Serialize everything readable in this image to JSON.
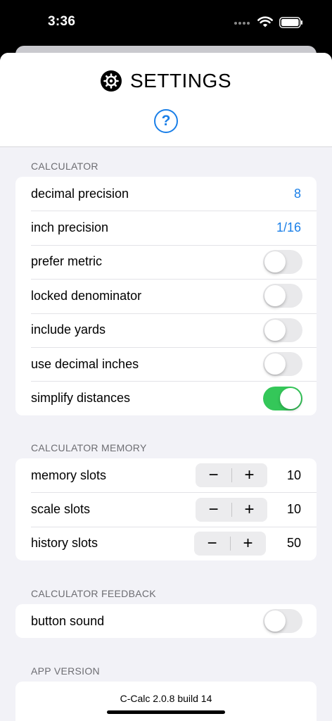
{
  "status_bar": {
    "time": "3:36"
  },
  "header": {
    "title": "SETTINGS",
    "help_label": "?"
  },
  "sections": {
    "calculator": {
      "label": "CALCULATOR",
      "decimal_precision": {
        "label": "decimal precision",
        "value": "8"
      },
      "inch_precision": {
        "label": "inch precision",
        "value": "1/16"
      },
      "prefer_metric": {
        "label": "prefer metric",
        "on": false
      },
      "locked_denominator": {
        "label": "locked denominator",
        "on": false
      },
      "include_yards": {
        "label": "include yards",
        "on": false
      },
      "use_decimal_inches": {
        "label": "use decimal inches",
        "on": false
      },
      "simplify_distances": {
        "label": "simplify distances",
        "on": true
      }
    },
    "memory": {
      "label": "CALCULATOR MEMORY",
      "memory_slots": {
        "label": "memory slots",
        "value": "10"
      },
      "scale_slots": {
        "label": "scale slots",
        "value": "10"
      },
      "history_slots": {
        "label": "history slots",
        "value": "50"
      },
      "minus": "−",
      "plus": "+"
    },
    "feedback": {
      "label": "CALCULATOR FEEDBACK",
      "button_sound": {
        "label": "button sound",
        "on": false
      }
    },
    "version": {
      "label": "APP VERSION",
      "text": "C-Calc 2.0.8 build 14"
    }
  },
  "colors": {
    "accent": "#1a7fe8",
    "toggle_on": "#34c759",
    "background": "#f2f2f7"
  }
}
